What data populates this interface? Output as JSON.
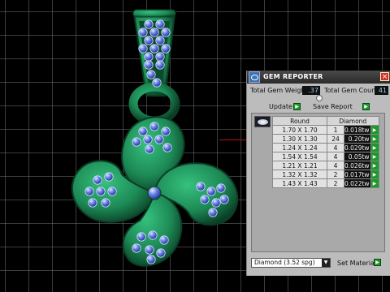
{
  "window": {
    "title": "GEM REPORTER",
    "close": "×"
  },
  "totals": {
    "weight_label": "Total Gem Weight",
    "weight_value": ".37",
    "count_label": "Total Gem Count",
    "count_value": "41"
  },
  "actions": {
    "update_label": "Update",
    "save_label": "Save Report",
    "go_glyph": "▶"
  },
  "table": {
    "headers": [
      "Round",
      "Diamond"
    ],
    "rows": [
      {
        "size": "1.70 X 1.70",
        "count": "1",
        "tw": "0.018tw"
      },
      {
        "size": "1.30 X 1.30",
        "count": "24",
        "tw": "0.20tw"
      },
      {
        "size": "1.24 X 1.24",
        "count": "4",
        "tw": "0.029tw"
      },
      {
        "size": "1.54 X 1.54",
        "count": "4",
        "tw": "0.05tw"
      },
      {
        "size": "1.21 X 1.21",
        "count": "4",
        "tw": "0.026tw"
      },
      {
        "size": "1.32 X 1.32",
        "count": "2",
        "tw": "0.017tw"
      },
      {
        "size": "1.43 X 1.43",
        "count": "2",
        "tw": "0.022tw"
      }
    ]
  },
  "material": {
    "selected": "Diamond    (3.52 spg)",
    "set_label": "Set Material"
  },
  "colors": {
    "metal": "#1d8a56",
    "gem": "#6a86e6",
    "accent": "#1a9a2a",
    "panel": "#bcbcbc"
  },
  "icons": [
    "gem-reporter-icon",
    "close-icon",
    "gem-shape-icon",
    "dropdown-arrow-icon",
    "go-arrow-icon"
  ]
}
